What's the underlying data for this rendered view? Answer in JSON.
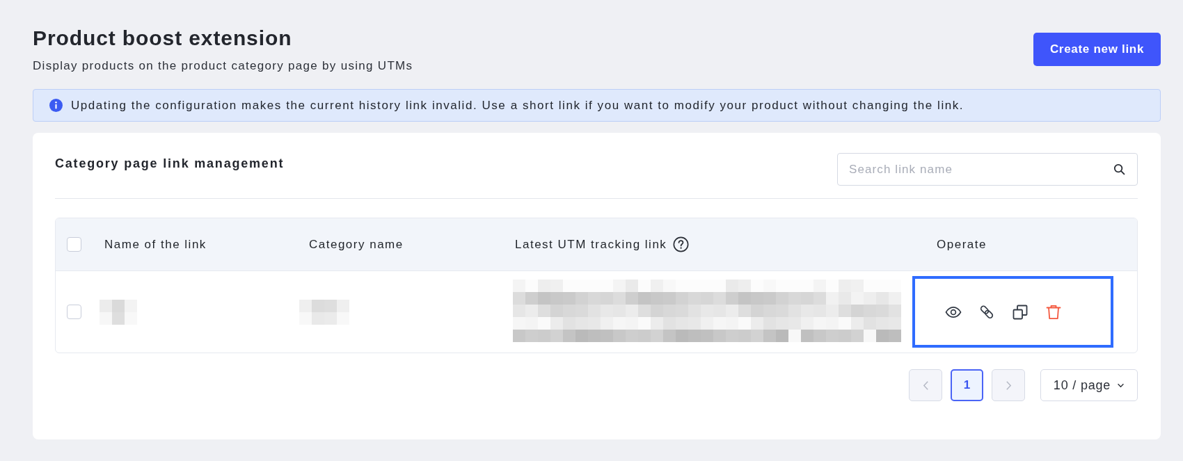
{
  "header": {
    "title": "Product boost extension",
    "subtitle": "Display products on the product category page by using UTMs",
    "primary_button": "Create new link"
  },
  "alert": {
    "kind": "info",
    "text": "Updating the configuration makes the current history link invalid. Use a short link if you want to modify your product without changing the link."
  },
  "card": {
    "title": "Category page link management",
    "search": {
      "placeholder": "Search link name"
    }
  },
  "table": {
    "select_all_checked": false,
    "columns": [
      {
        "label": "Name of the link",
        "help": false
      },
      {
        "label": "Category name",
        "help": false
      },
      {
        "label": "Latest UTM tracking link",
        "help": true
      },
      {
        "label": "Operate",
        "help": false
      }
    ],
    "rows": [
      {
        "selected": false,
        "redacted": true,
        "operate_highlighted": true
      }
    ]
  },
  "pagination": {
    "prev_disabled": true,
    "pages": [
      {
        "label": "1",
        "selected": true
      }
    ],
    "next_disabled": true,
    "page_size": "10 / page"
  }
}
